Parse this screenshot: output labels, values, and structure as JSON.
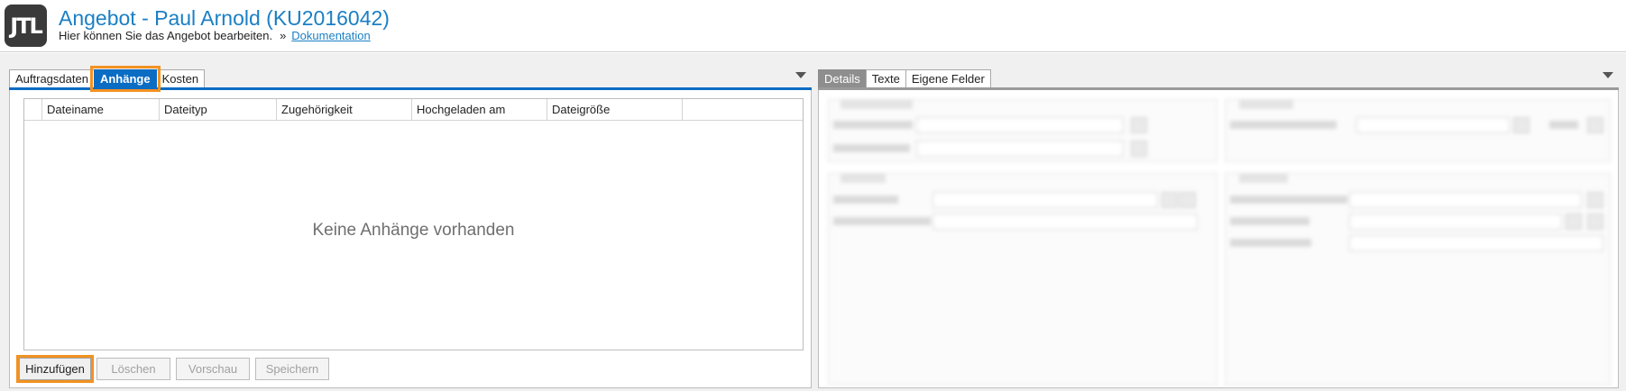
{
  "header": {
    "logo_text": "JTL",
    "title": "Angebot - Paul Arnold (KU2016042)",
    "subtitle": "Hier können Sie das Angebot bearbeiten.",
    "separator": "»",
    "doc_link": "Dokumentation"
  },
  "left_panel": {
    "tabs": [
      "Auftragsdaten",
      "Anhänge",
      "Kosten"
    ],
    "active_tab": "Anhänge",
    "columns": [
      "Dateiname",
      "Dateityp",
      "Zugehörigkeit",
      "Hochgeladen am",
      "Dateigröße"
    ],
    "empty_message": "Keine Anhänge vorhanden",
    "buttons": {
      "add": "Hinzufügen",
      "delete": "Löschen",
      "preview": "Vorschau",
      "save": "Speichern"
    }
  },
  "right_panel": {
    "tabs": [
      "Details",
      "Texte",
      "Eigene Felder"
    ],
    "active_tab": "Details"
  },
  "colors": {
    "accent_blue": "#0b6cc4",
    "title_blue": "#1b7fc4",
    "highlight_orange": "#f29222"
  },
  "icons": {
    "tab_menu": "chevron-down-icon",
    "logo": "jtl-logo"
  }
}
